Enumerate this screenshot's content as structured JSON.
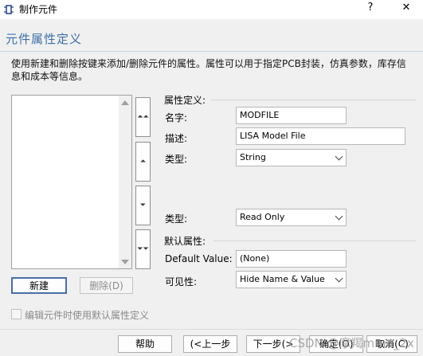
{
  "window": {
    "title": "制作元件",
    "help": "?",
    "close": "✕"
  },
  "page_title": "元件属性定义",
  "description": "使用新建和删除按键来添加/删除元件的属性。属性可以用于指定PCB封装，仿真参数，库存信息和成本等信息。",
  "left": {
    "new_label": "新建",
    "delete_label": "删除(D)",
    "move_buttons": [
      "⏶⏶",
      "⏶",
      "⏷",
      "⏷⏷"
    ]
  },
  "property_definition": {
    "group_title": "属性定义:",
    "name_label": "名字:",
    "name_value": "MODFILE",
    "desc_label": "描述:",
    "desc_value": "LISA Model File",
    "type_label": "类型:",
    "type_value": "String",
    "type2_label": "类型:",
    "type2_value": "Read Only"
  },
  "default_property": {
    "group_title": "默认属性:",
    "default_value_label": "Default Value:",
    "default_value": "(None)",
    "visibility_label": "可见性:",
    "visibility_value": "Hide Name & Value"
  },
  "checkbox_label": "编辑元件时使用默认属性定义",
  "footer": {
    "help": "帮助",
    "back": "(<上一步",
    "next": "下一步(>",
    "ok": "确定(O)",
    "cancel": "取消(C)"
  },
  "watermark": "CSDN @摩羯mmo_2x"
}
